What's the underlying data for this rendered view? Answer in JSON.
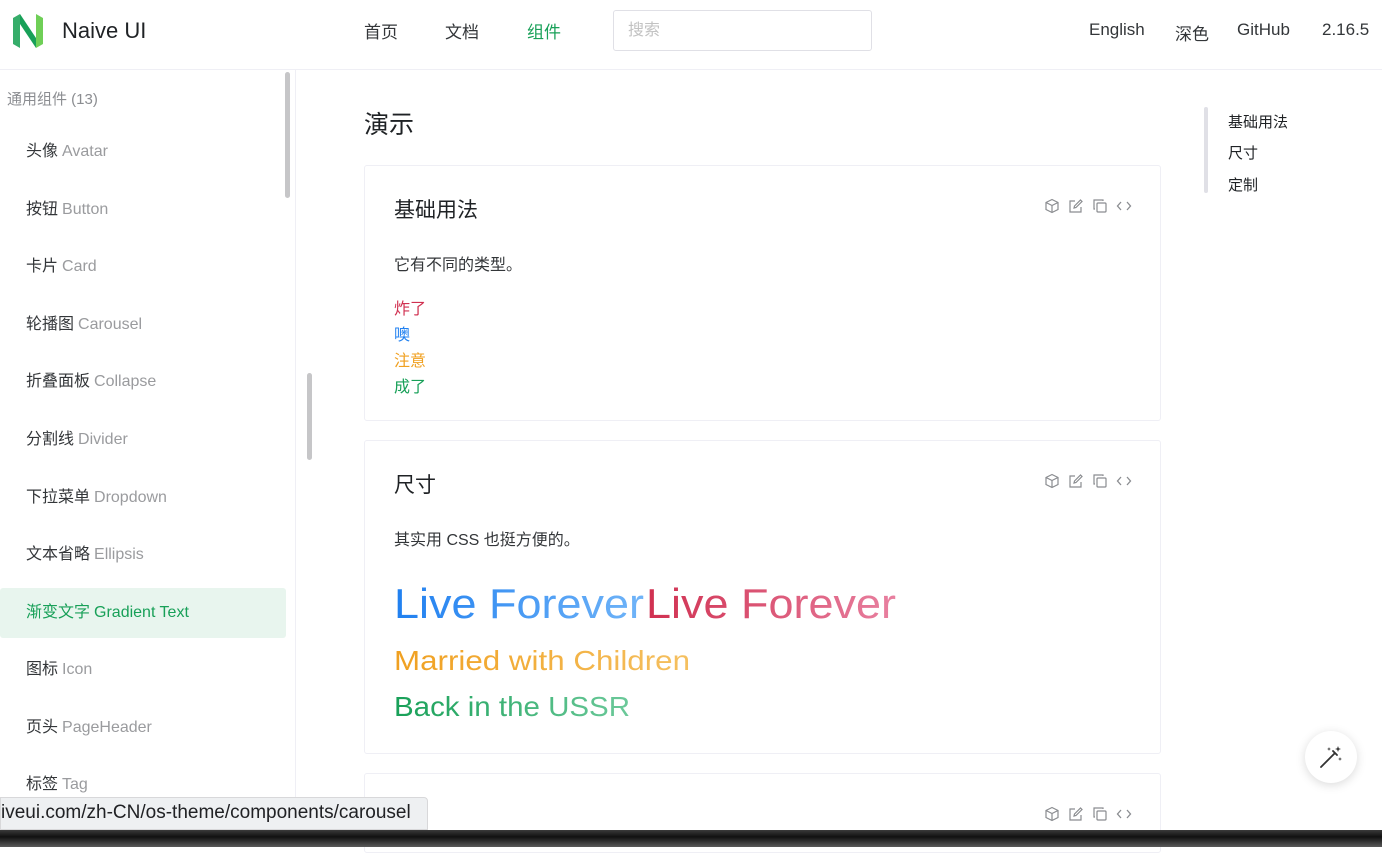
{
  "header": {
    "brand": "Naive UI",
    "nav": [
      {
        "label": "首页",
        "active": false
      },
      {
        "label": "文档",
        "active": false
      },
      {
        "label": "组件",
        "active": true
      }
    ],
    "search_placeholder": "搜索",
    "right_nav": [
      "English",
      "深色",
      "GitHub",
      "2.16.5"
    ],
    "accent_color": "#18a058"
  },
  "sidebar": {
    "group_label": "通用组件 (13)",
    "items": [
      {
        "zh": "头像",
        "en": "Avatar"
      },
      {
        "zh": "按钮",
        "en": "Button"
      },
      {
        "zh": "卡片",
        "en": "Card"
      },
      {
        "zh": "轮播图",
        "en": "Carousel"
      },
      {
        "zh": "折叠面板",
        "en": "Collapse"
      },
      {
        "zh": "分割线",
        "en": "Divider"
      },
      {
        "zh": "下拉菜单",
        "en": "Dropdown"
      },
      {
        "zh": "文本省略",
        "en": "Ellipsis"
      },
      {
        "zh": "渐变文字",
        "en": "Gradient Text",
        "active": true
      },
      {
        "zh": "图标",
        "en": "Icon"
      },
      {
        "zh": "页头",
        "en": "PageHeader"
      },
      {
        "zh": "标签",
        "en": "Tag"
      }
    ]
  },
  "main": {
    "title": "演示",
    "basic": {
      "title": "基础用法",
      "description": "它有不同的类型。",
      "lines": [
        {
          "text": "炸了",
          "color": "#d03050"
        },
        {
          "text": "噢",
          "color": "#2080f0"
        },
        {
          "text": "注意",
          "color": "#f0a020"
        },
        {
          "text": "成了",
          "color": "#18a058"
        }
      ]
    },
    "size": {
      "title": "尺寸",
      "description": "其实用 CSS 也挺方便的。",
      "line1a": "Live Forever",
      "line1b": "Live Forever",
      "line2": "Married with Children",
      "line3": "Back in the USSR"
    }
  },
  "toc": [
    "基础用法",
    "尺寸",
    "定制"
  ],
  "status_url": "iveui.com/zh-CN/os-theme/components/carousel",
  "icons": [
    "cube-icon",
    "edit-icon",
    "copy-icon",
    "code-icon",
    "magic-wand-icon"
  ]
}
